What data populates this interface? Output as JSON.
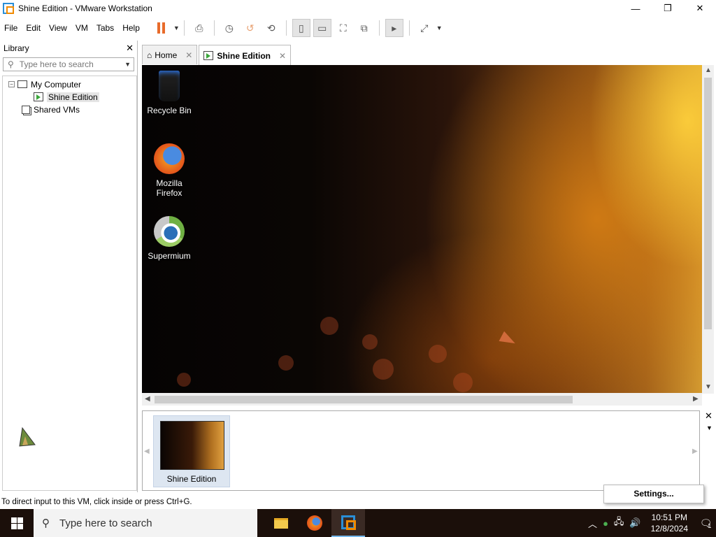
{
  "window": {
    "title": "Shine Edition - VMware Workstation"
  },
  "menu": [
    "File",
    "Edit",
    "View",
    "VM",
    "Tabs",
    "Help"
  ],
  "library": {
    "title": "Library",
    "search_placeholder": "Type here to search",
    "tree": {
      "root": "My Computer",
      "vm": "Shine Edition",
      "shared": "Shared VMs"
    }
  },
  "tabs": [
    {
      "label": "Home"
    },
    {
      "label": "Shine Edition"
    }
  ],
  "desktop_icons": [
    {
      "label": "Recycle Bin",
      "icon": "recycle-bin-icon"
    },
    {
      "label": "Mozilla Firefox",
      "icon": "firefox-icon"
    },
    {
      "label": "Supermium",
      "icon": "supermium-icon"
    }
  ],
  "thumbnail": {
    "caption": "Shine Edition"
  },
  "statusbar": {
    "text": "To direct input to this VM, click inside or press Ctrl+G."
  },
  "settings_popup": {
    "label": "Settings..."
  },
  "taskbar": {
    "search_placeholder": "Type here to search",
    "time": "10:51 PM",
    "date": "12/8/2024",
    "notification_count": "1"
  }
}
